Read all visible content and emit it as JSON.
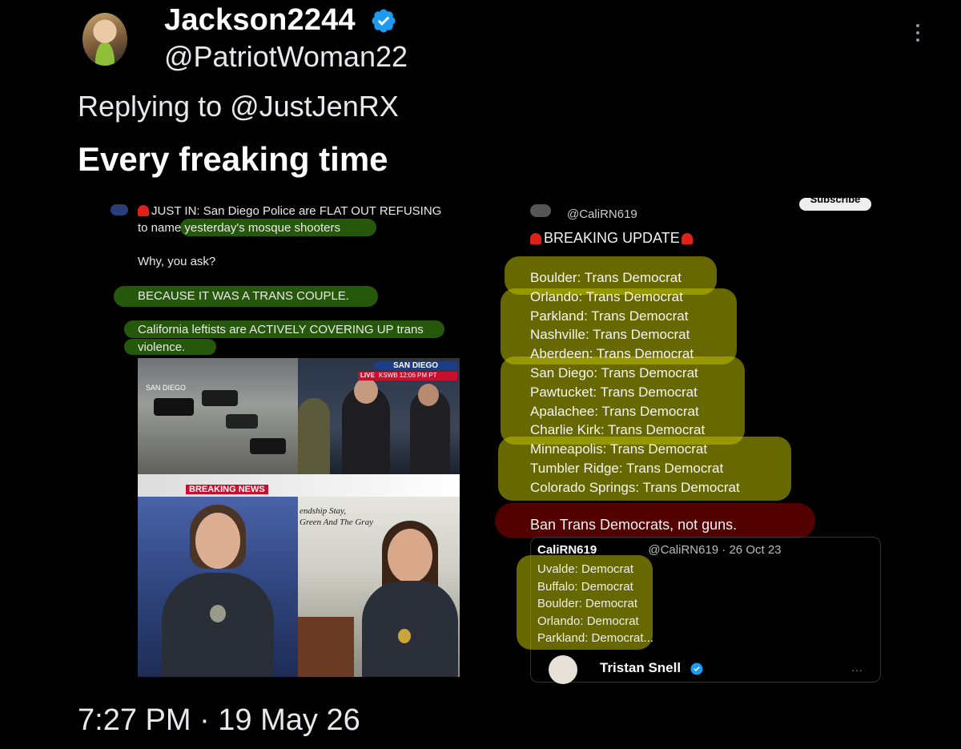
{
  "header": {
    "display_name": "Jackson2244",
    "handle": "@PatriotWoman22"
  },
  "reply_line": "Replying to @JustJenRX",
  "body": "Every freaking time",
  "timestamp": "7:27 PM · 19 May 26",
  "left_post": {
    "line1": "JUST IN: San Diego Police are FLAT OUT REFUSING",
    "line2": "to name yesterday's mosque shooters",
    "why": "Why, you ask?",
    "because": "BECAUSE IT WAS A TRANS COUPLE.",
    "cal1": "California leftists are ACTIVELY COVERING UP trans",
    "cal2": "violence.",
    "news_location": "SAN DIEGO",
    "news_live": "LIVE",
    "news_station": "KSWB 12:06 PM PT",
    "news_location_small": "SAN DIEGO",
    "breaking_news": "BREAKING NEWS",
    "banner_text_1": "endship Stay,",
    "banner_text_2": "Green And The Gray"
  },
  "right_post": {
    "handle": "@CaliRN619",
    "subscribe": "Subscribe",
    "breaking": "BREAKING UPDATE",
    "list": [
      "Boulder: Trans Democrat",
      "Orlando: Trans Democrat",
      "Parkland: Trans Democrat",
      "Nashville: Trans Democrat",
      "Aberdeen: Trans Democrat",
      "San Diego: Trans Democrat",
      "Pawtucket: Trans Democrat",
      "Apalachee: Trans Democrat",
      "Charlie Kirk: Trans Democrat",
      "Minneapolis: Trans Democrat",
      "Tumbler Ridge: Trans Democrat",
      "Colorado Springs: Trans Democrat"
    ],
    "ban": "Ban Trans Democrats, not guns.",
    "quote_name": "CaliRN619",
    "quote_handle_date": "@CaliRN619 · 26 Oct 23",
    "quote_list": [
      "Uvalde: Democrat",
      "Buffalo: Democrat",
      "Boulder: Democrat",
      "Orlando: Democrat",
      "Parkland: Democrat..."
    ],
    "nested_name": "Tristan Snell"
  },
  "colors": {
    "verified_blue": "#1d9bf0",
    "highlight_green": "#46a014",
    "highlight_yellow": "#bebe00",
    "highlight_red": "#960000"
  },
  "icons": [
    "verified-badge-icon",
    "more-options-icon",
    "siren-icon"
  ]
}
